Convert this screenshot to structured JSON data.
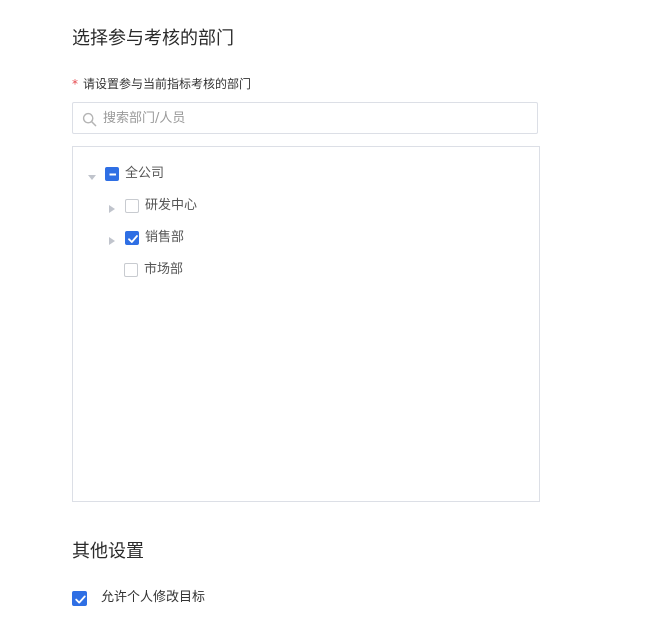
{
  "sections": {
    "participants_title": "选择参与考核的部门",
    "other_title": "其他设置"
  },
  "field": {
    "required_mark": "*",
    "label": "请设置参与当前指标考核的部门"
  },
  "search": {
    "placeholder": "搜索部门/人员",
    "value": "",
    "icon": "search-icon"
  },
  "tree": {
    "root": {
      "label": "全公司",
      "state": "indeterminate",
      "expanded": true
    },
    "children": [
      {
        "label": "研发中心",
        "state": "unchecked",
        "has_children": true
      },
      {
        "label": "销售部",
        "state": "checked",
        "has_children": true
      },
      {
        "label": "市场部",
        "state": "unchecked",
        "has_children": false
      }
    ]
  },
  "options": {
    "allow_personal_edit": {
      "label": "允许个人修改目标",
      "checked": true
    }
  },
  "colors": {
    "accent": "#2f6fe4",
    "required": "#e5484d",
    "border": "#dcdfe6"
  }
}
